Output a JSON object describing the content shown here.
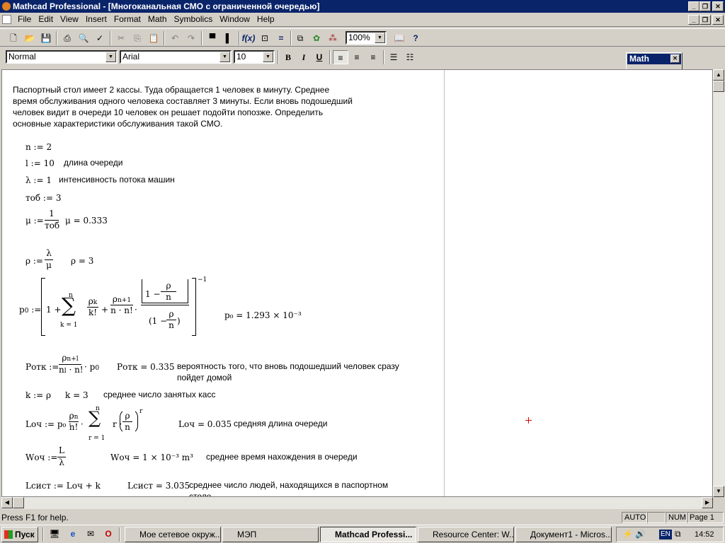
{
  "window": {
    "title": "Mathcad Professional - [Многоканальная СМО с ограниченной очередью]"
  },
  "menu": [
    "File",
    "Edit",
    "View",
    "Insert",
    "Format",
    "Math",
    "Symbolics",
    "Window",
    "Help"
  ],
  "format": {
    "style": "Normal",
    "font": "Arial",
    "size": "10",
    "zoom": "100%"
  },
  "palette": {
    "title": "Math"
  },
  "problem": [
    "Паспортный стол имеет 2 кассы. Туда обращается 1 человек в минуту. Среднее",
    "время обслуживания одного человека составляет 3 минуты. Если вновь подошедший",
    "человек видит в очереди 10 человек он решает подойти попозже. Определить",
    "основные характеристики обслуживания такой СМО."
  ],
  "defs": {
    "n": "n := 2",
    "l": "l := 10",
    "l_desc": "длина очереди",
    "lam": "λ := 1",
    "lam_desc": "интенсивность потока машин",
    "tob": "тоб := 3",
    "mu_lhs": "μ :=",
    "mu_num": "1",
    "mu_den": "тоб",
    "mu_res": "μ = 0.333",
    "rho_lhs": "ρ :=",
    "rho_num": "λ",
    "rho_den": "μ",
    "rho_res": "ρ = 3",
    "p0_res": "p₀ = 1.293 × 10⁻³",
    "potk_lhs": "Ротк :=",
    "potk_res": "Ротк = 0.335",
    "potk_desc1": "вероятность того, что вновь подошедший человек сразу",
    "potk_desc2": "пойдет домой",
    "k": "k := ρ",
    "k_res": "k = 3",
    "k_desc": "среднее число занятых касс",
    "loch_lhs": "Lоч := p₀ ·",
    "loch_res": "Lоч = 0.035",
    "loch_desc": "средняя длина очереди",
    "woch_lhs": "Wоч :=",
    "woch_num": "L",
    "woch_den": "λ",
    "woch_res": "Wоч = 1 × 10⁻³ m³",
    "woch_desc": "среднее время нахождения в очереди",
    "lsist": "Lсист := Lоч + k",
    "lsist_res": "Lсист = 3.035",
    "lsist_desc1": "среднее число людей, находящихся в паспортном",
    "lsist_desc2": "столе"
  },
  "status": {
    "help": "Press F1 for help.",
    "auto": "AUTO",
    "num": "NUM",
    "page": "Page 1"
  },
  "taskbar": {
    "start": "Пуск",
    "tasks": [
      "Мое сетевое окруж...",
      "МЭП",
      "Mathcad Professi...",
      "Resource Center: W...",
      "Документ1 - Micros..."
    ],
    "lang": "EN",
    "time": "14:52"
  }
}
